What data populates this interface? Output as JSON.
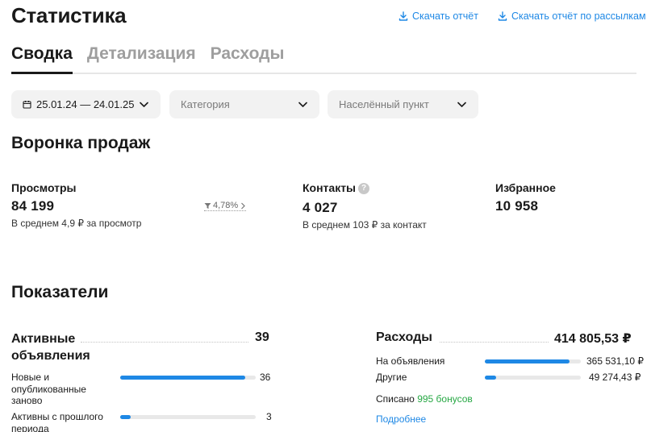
{
  "header": {
    "title": "Статистика",
    "download_report": "Скачать отчёт",
    "download_mailing_report": "Скачать отчёт по рассылкам"
  },
  "tabs": [
    {
      "label": "Сводка",
      "active": true
    },
    {
      "label": "Детализация",
      "active": false
    },
    {
      "label": "Расходы",
      "active": false
    }
  ],
  "filters": {
    "date_range": "25.01.24 — 24.01.25",
    "category_placeholder": "Категория",
    "city_placeholder": "Населённый пункт"
  },
  "funnel": {
    "title": "Воронка продаж",
    "views": {
      "label": "Просмотры",
      "value": "84 199",
      "sub": "В среднем 4,9 ₽ за просмотр"
    },
    "conversion": "4,78%",
    "contacts": {
      "label": "Контакты",
      "value": "4 027",
      "sub": "В среднем 103 ₽ за контакт"
    },
    "favorites": {
      "label": "Избранное",
      "value": "10 958"
    }
  },
  "indicators": {
    "title": "Показатели",
    "active_ads": {
      "label": "Активные объявления",
      "value": "39",
      "rows": [
        {
          "label": "Новые и опубликованные заново",
          "value": "36",
          "fraction": 0.92
        },
        {
          "label": "Активны с прошлого периода",
          "value": "3",
          "fraction": 0.077
        }
      ]
    },
    "expenses": {
      "label": "Расходы",
      "value": "414 805,53 ₽",
      "rows": [
        {
          "label": "На объявления",
          "value": "365 531,10 ₽",
          "fraction": 0.88
        },
        {
          "label": "Другие",
          "value": "49 274,43 ₽",
          "fraction": 0.12
        }
      ],
      "written_off_prefix": "Списано",
      "written_off_bonus": "995 бонусов",
      "more": "Подробнее"
    }
  },
  "colors": {
    "accent": "#1e88e5",
    "bonus": "#27a844",
    "filter_bg": "#f2f2f2"
  }
}
